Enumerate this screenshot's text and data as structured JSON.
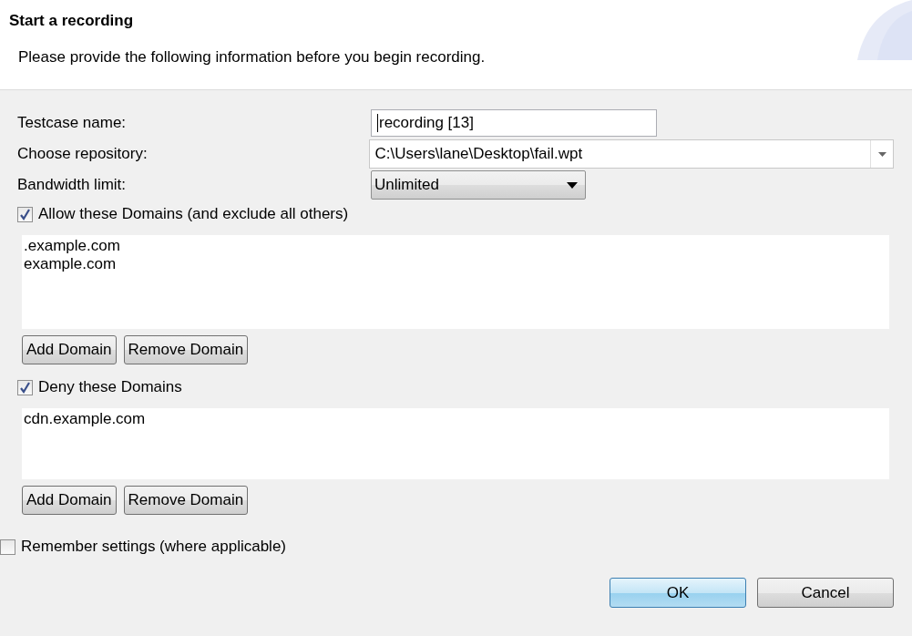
{
  "header": {
    "title": "Start a recording",
    "description": "Please provide the following information before you begin recording."
  },
  "fields": [
    {
      "kind": "text",
      "label": "Testcase name:",
      "value": "recording [13]"
    },
    {
      "kind": "combo",
      "label": "Choose repository:",
      "value": "C:\\Users\\lane\\Desktop\\fail.wpt"
    },
    {
      "kind": "dropdown",
      "label": "Bandwidth limit:",
      "value": "Unlimited"
    }
  ],
  "domain_sections": [
    {
      "label": "Allow these Domains (and exclude all others)",
      "checked": true,
      "entries": [
        ".example.com",
        "example.com"
      ],
      "buttons": [
        "Add Domain",
        "Remove Domain"
      ]
    },
    {
      "label": "Deny these Domains",
      "checked": true,
      "entries": [
        "cdn.example.com"
      ],
      "buttons": [
        "Add Domain",
        "Remove Domain"
      ]
    }
  ],
  "remember": {
    "label": "Remember settings (where applicable)",
    "checked": false
  },
  "buttons": [
    {
      "label": "OK",
      "kind": "default"
    },
    {
      "label": "Cancel",
      "kind": "normal"
    }
  ]
}
